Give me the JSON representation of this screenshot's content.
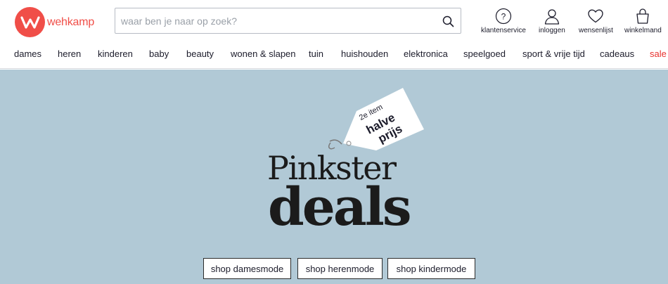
{
  "brand": {
    "name": "wehkamp",
    "color": "#f04e48"
  },
  "search": {
    "placeholder": "waar ben je naar op zoek?",
    "value": ""
  },
  "utility": {
    "service": "klantenservice",
    "login": "inloggen",
    "wishlist": "wensenlijst",
    "cart": "winkelmand"
  },
  "nav": [
    "dames",
    "heren",
    "kinderen",
    "baby",
    "beauty",
    "wonen & slapen",
    "tuin",
    "huishouden",
    "elektronica",
    "speelgoed",
    "sport & vrije tijd",
    "cadeaus",
    "sale"
  ],
  "hero": {
    "background": "#b1c9d6",
    "tag_line1": "2e item",
    "tag_line2": "halve",
    "tag_line3": "prijs",
    "title_line1": "Pinkster",
    "title_line2": "deals",
    "buttons": [
      "shop damesmode",
      "shop herenmode",
      "shop kindermode"
    ]
  }
}
